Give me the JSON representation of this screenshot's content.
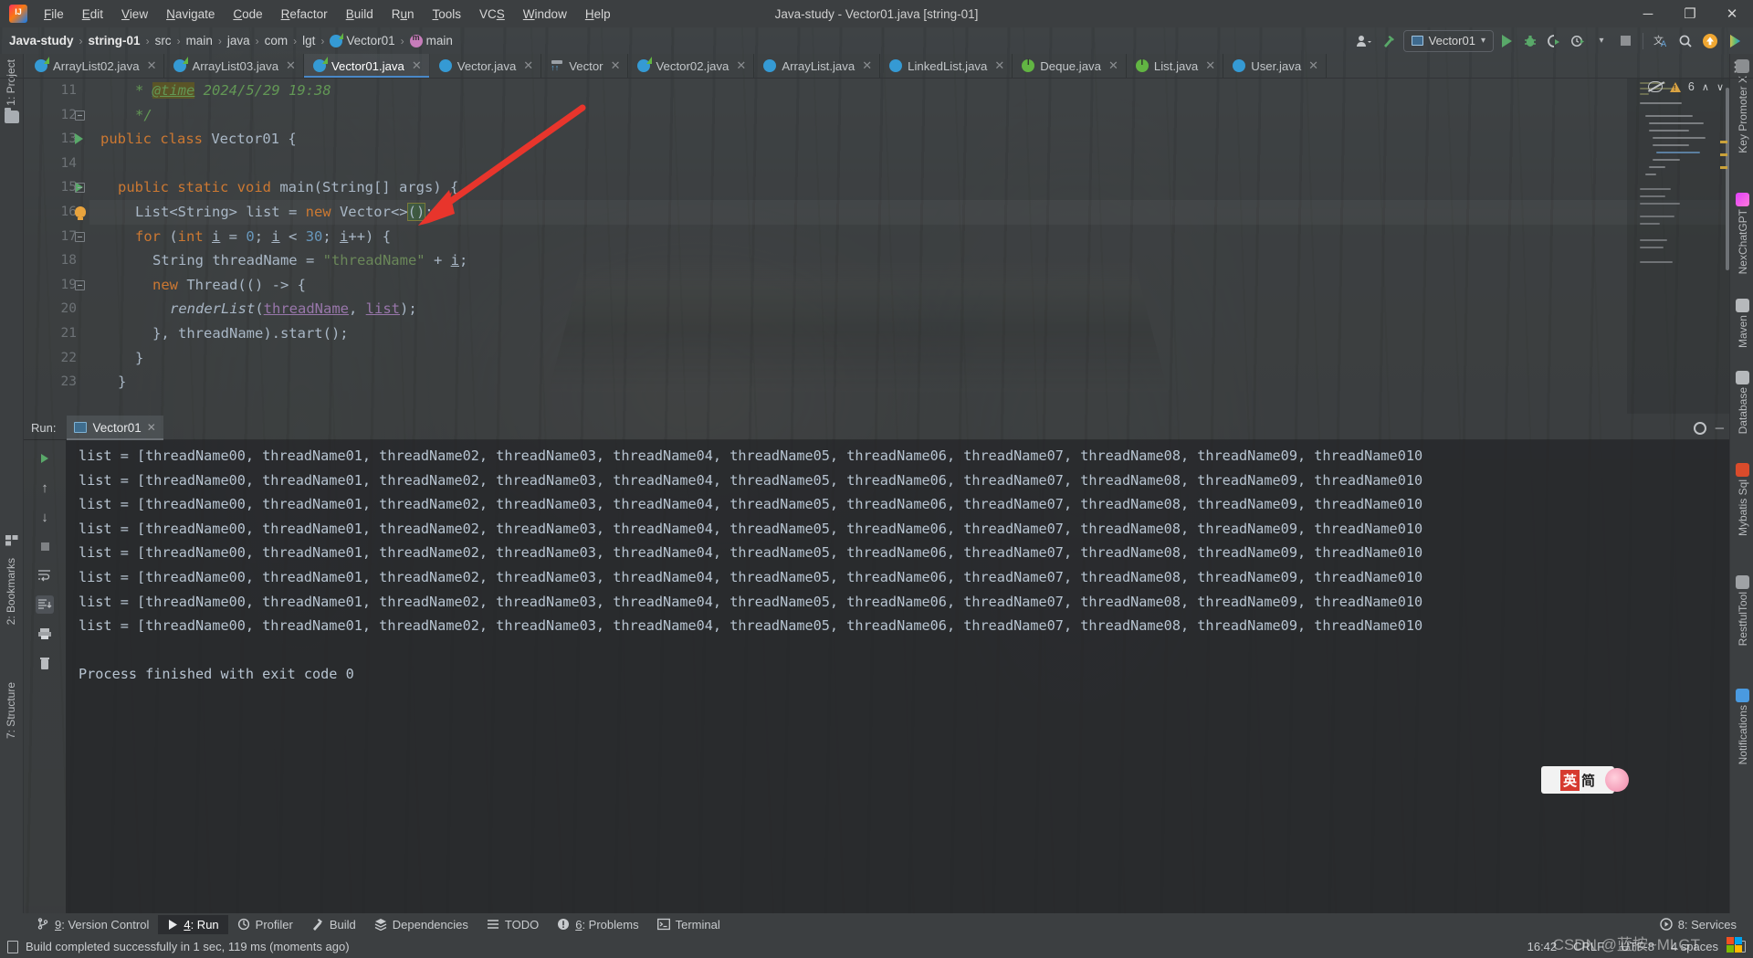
{
  "window": {
    "title": "Java-study - Vector01.java [string-01]",
    "logo_icon": "intellij-idea-logo",
    "minimize_label": "─",
    "maximize_label": "❐",
    "close_label": "✕"
  },
  "menubar": {
    "items": [
      {
        "label": "File",
        "mnemonic": "F"
      },
      {
        "label": "Edit",
        "mnemonic": "E"
      },
      {
        "label": "View",
        "mnemonic": "V"
      },
      {
        "label": "Navigate",
        "mnemonic": "N"
      },
      {
        "label": "Code",
        "mnemonic": "C"
      },
      {
        "label": "Refactor",
        "mnemonic": "R"
      },
      {
        "label": "Build",
        "mnemonic": "B"
      },
      {
        "label": "Run",
        "mnemonic": "u"
      },
      {
        "label": "Tools",
        "mnemonic": "T"
      },
      {
        "label": "VCS",
        "mnemonic": "S"
      },
      {
        "label": "Window",
        "mnemonic": "W"
      },
      {
        "label": "Help",
        "mnemonic": "H"
      }
    ]
  },
  "breadcrumb": {
    "items": [
      {
        "label": "Java-study",
        "bold": true,
        "icon": null
      },
      {
        "label": "string-01",
        "bold": true,
        "icon": null
      },
      {
        "label": "src",
        "bold": false,
        "icon": null
      },
      {
        "label": "main",
        "bold": false,
        "icon": null
      },
      {
        "label": "java",
        "bold": false,
        "icon": null
      },
      {
        "label": "com",
        "bold": false,
        "icon": null
      },
      {
        "label": "lgt",
        "bold": false,
        "icon": null
      },
      {
        "label": "Vector01",
        "bold": false,
        "icon": "class-icon"
      },
      {
        "label": "main",
        "bold": false,
        "icon": "method-icon"
      }
    ],
    "separator": "›"
  },
  "toolbar_right": {
    "account_icon": "account-icon",
    "build_icon": "hammer-icon",
    "run_config": {
      "label": "Vector01",
      "icon": "run-config-icon",
      "dropdown": "▾"
    },
    "run_icon": "run-play-icon",
    "debug_icon": "debug-bug-icon",
    "run_coverage_icon": "run-with-coverage-icon",
    "profiler_icon": "profiler-icon",
    "stop_icon": "stop-icon",
    "translate_icon": "translate-icon",
    "search_icon": "search-icon",
    "update_icon": "update-available-icon",
    "plugin_icon": "plugin-icon"
  },
  "tabs": {
    "more_icon": "more-tabs-icon",
    "close_glyph": "✕",
    "items": [
      {
        "label": "ArrayList02.java",
        "icon": "java-class-runnable-icon",
        "active": false
      },
      {
        "label": "ArrayList03.java",
        "icon": "java-class-runnable-icon",
        "active": false
      },
      {
        "label": "Vector01.java",
        "icon": "java-class-runnable-icon",
        "active": true
      },
      {
        "label": "Vector.java",
        "icon": "java-class-icon",
        "active": false
      },
      {
        "label": "Vector",
        "icon": "library-class-icon",
        "active": false
      },
      {
        "label": "Vector02.java",
        "icon": "java-class-runnable-icon",
        "active": false
      },
      {
        "label": "ArrayList.java",
        "icon": "java-class-icon",
        "active": false
      },
      {
        "label": "LinkedList.java",
        "icon": "java-class-icon",
        "active": false
      },
      {
        "label": "Deque.java",
        "icon": "java-interface-icon",
        "active": false
      },
      {
        "label": "List.java",
        "icon": "java-interface-icon",
        "active": false
      },
      {
        "label": "User.java",
        "icon": "java-class-icon",
        "active": false
      }
    ]
  },
  "left_strip": {
    "project_label": "1: Project",
    "project_icon": "folder-icon",
    "bookmarks_label": "2: Bookmarks",
    "structure_label": "7: Structure"
  },
  "right_strip": {
    "items": [
      {
        "label": "Key Promoter X",
        "icon": "key-promoter-icon"
      },
      {
        "label": "NexChatGPT",
        "icon": "nexchatgpt-icon"
      },
      {
        "label": "Maven",
        "icon": "maven-icon"
      },
      {
        "label": "Database",
        "icon": "database-icon"
      },
      {
        "label": "Mybatis Sql",
        "icon": "mybatis-icon"
      },
      {
        "label": "RestfulTool",
        "icon": "restful-tool-icon"
      },
      {
        "label": "Notifications",
        "icon": "notifications-bell-icon"
      }
    ]
  },
  "editor": {
    "inspection": {
      "eye_icon": "inspection-eye-off-icon",
      "warning_icon": "warning-triangle-icon",
      "warning_count": "6",
      "up_icon": "∧",
      "down_icon": "∨"
    },
    "lines": [
      {
        "no": "11",
        "indent": 2,
        "segments": [
          {
            "t": "* ",
            "c": "cmt"
          },
          {
            "t": "@time",
            "c": "tag"
          },
          {
            "t": " 2024/5/29 19:38",
            "c": "cmt"
          }
        ]
      },
      {
        "no": "12",
        "indent": 2,
        "fold": true,
        "segments": [
          {
            "t": "*/",
            "c": "cmt"
          }
        ]
      },
      {
        "no": "13",
        "indent": 0,
        "run": true,
        "segments": [
          {
            "t": "public class ",
            "c": "k"
          },
          {
            "t": "Vector01 ",
            "c": "typ"
          },
          {
            "t": "{",
            "c": "typ"
          }
        ]
      },
      {
        "no": "14",
        "indent": 0,
        "segments": []
      },
      {
        "no": "15",
        "indent": 1,
        "run": true,
        "fold": true,
        "segments": [
          {
            "t": "public static ",
            "c": "k"
          },
          {
            "t": "void ",
            "c": "k"
          },
          {
            "t": "main",
            "c": "typ"
          },
          {
            "t": "(String[] args) {",
            "c": "typ"
          }
        ]
      },
      {
        "no": "16",
        "indent": 2,
        "bulb": true,
        "highlight": true,
        "segments": [
          {
            "t": "List<String> list = ",
            "c": "typ"
          },
          {
            "t": "new ",
            "c": "k"
          },
          {
            "t": "Vector<>",
            "c": "typ"
          },
          {
            "t": "()",
            "c": "brace"
          },
          {
            "t": ";",
            "c": "typ"
          }
        ]
      },
      {
        "no": "17",
        "indent": 2,
        "fold": true,
        "segments": [
          {
            "t": "for ",
            "c": "k"
          },
          {
            "t": "(",
            "c": "typ"
          },
          {
            "t": "int ",
            "c": "k"
          },
          {
            "t": "i",
            "c": "var-u"
          },
          {
            "t": " = ",
            "c": "typ"
          },
          {
            "t": "0",
            "c": "num"
          },
          {
            "t": "; ",
            "c": "typ"
          },
          {
            "t": "i",
            "c": "var-u"
          },
          {
            "t": " < ",
            "c": "typ"
          },
          {
            "t": "30",
            "c": "num"
          },
          {
            "t": "; ",
            "c": "typ"
          },
          {
            "t": "i",
            "c": "var-u"
          },
          {
            "t": "++) {",
            "c": "typ"
          }
        ]
      },
      {
        "no": "18",
        "indent": 3,
        "segments": [
          {
            "t": "String threadName = ",
            "c": "typ"
          },
          {
            "t": "\"threadName\"",
            "c": "str"
          },
          {
            "t": " + ",
            "c": "typ"
          },
          {
            "t": "i",
            "c": "var-u"
          },
          {
            "t": ";",
            "c": "typ"
          }
        ]
      },
      {
        "no": "19",
        "indent": 3,
        "fold": true,
        "segments": [
          {
            "t": "new ",
            "c": "k"
          },
          {
            "t": "Thread(() -> {",
            "c": "typ"
          }
        ]
      },
      {
        "no": "20",
        "indent": 4,
        "segments": [
          {
            "t": "renderList",
            "c": "mth"
          },
          {
            "t": "(",
            "c": "typ"
          },
          {
            "t": "threadName",
            "c": "par"
          },
          {
            "t": ", ",
            "c": "typ"
          },
          {
            "t": "list",
            "c": "par"
          },
          {
            "t": ");",
            "c": "typ"
          }
        ]
      },
      {
        "no": "21",
        "indent": 3,
        "segments": [
          {
            "t": "}, threadName).start();",
            "c": "typ"
          }
        ]
      },
      {
        "no": "22",
        "indent": 2,
        "segments": [
          {
            "t": "}",
            "c": "typ"
          }
        ]
      },
      {
        "no": "23",
        "indent": 1,
        "segments": [
          {
            "t": "}",
            "c": "typ"
          }
        ]
      }
    ]
  },
  "run_window": {
    "label": "Run:",
    "tab": {
      "label": "Vector01",
      "icon": "run-tab-icon",
      "close": "✕"
    },
    "settings_icon": "gear-icon",
    "minimize_icon": "─",
    "side_buttons": [
      {
        "icon": "rerun-icon",
        "name": "rerun-button"
      },
      {
        "icon": "scroll-up-icon",
        "name": "up-button"
      },
      {
        "icon": "scroll-down-icon",
        "name": "down-button"
      },
      {
        "icon": "stop-icon",
        "name": "stop-button"
      },
      {
        "icon": "soft-wrap-icon",
        "name": "soft-wrap-button"
      },
      {
        "icon": "scroll-to-end-icon",
        "name": "scroll-to-end-button"
      },
      {
        "icon": "print-icon",
        "name": "print-button"
      },
      {
        "icon": "clear-all-icon",
        "name": "clear-all-button"
      }
    ],
    "console_line": "list = [threadName00, threadName01, threadName02, threadName03, threadName04, threadName05, threadName06, threadName07, threadName08, threadName09, threadName010",
    "console_lines": [
      "list = [threadName00, threadName01, threadName02, threadName03, threadName04, threadName05, threadName06, threadName07, threadName08, threadName09, threadName010",
      "list = [threadName00, threadName01, threadName02, threadName03, threadName04, threadName05, threadName06, threadName07, threadName08, threadName09, threadName010",
      "list = [threadName00, threadName01, threadName02, threadName03, threadName04, threadName05, threadName06, threadName07, threadName08, threadName09, threadName010",
      "list = [threadName00, threadName01, threadName02, threadName03, threadName04, threadName05, threadName06, threadName07, threadName08, threadName09, threadName010",
      "list = [threadName00, threadName01, threadName02, threadName03, threadName04, threadName05, threadName06, threadName07, threadName08, threadName09, threadName010",
      "list = [threadName00, threadName01, threadName02, threadName03, threadName04, threadName05, threadName06, threadName07, threadName08, threadName09, threadName010",
      "list = [threadName00, threadName01, threadName02, threadName03, threadName04, threadName05, threadName06, threadName07, threadName08, threadName09, threadName010",
      "list = [threadName00, threadName01, threadName02, threadName03, threadName04, threadName05, threadName06, threadName07, threadName08, threadName09, threadName010"
    ],
    "finish_line": "Process finished with exit code 0"
  },
  "bottom_bar": {
    "items": [
      {
        "label": "9: Version Control",
        "mnemonic": "9",
        "icon": "version-control-icon",
        "active": false
      },
      {
        "label": "4: Run",
        "mnemonic": "4",
        "icon": "run-play-icon",
        "active": true
      },
      {
        "label": "Profiler",
        "mnemonic": "",
        "icon": "profiler-icon",
        "active": false
      },
      {
        "label": "Build",
        "mnemonic": "",
        "icon": "hammer-icon",
        "active": false
      },
      {
        "label": "Dependencies",
        "mnemonic": "",
        "icon": "dependencies-icon",
        "active": false
      },
      {
        "label": "TODO",
        "mnemonic": "",
        "icon": "todo-list-icon",
        "active": false
      },
      {
        "label": "6: Problems",
        "mnemonic": "6",
        "icon": "problems-icon",
        "active": false
      },
      {
        "label": "Terminal",
        "mnemonic": "",
        "icon": "terminal-icon",
        "active": false
      }
    ],
    "services": {
      "label": "8: Services",
      "mnemonic": "8",
      "icon": "services-icon"
    }
  },
  "status_bar": {
    "message": "Build completed successfully in 1 sec, 119 ms (moments ago)",
    "message_icon": "build-status-icon",
    "time": "16:42",
    "line_separator": "CRLF",
    "encoding": "UTF-8",
    "indent": "4 spaces",
    "lock_icon": "lock-icon"
  },
  "overlay": {
    "ime_badge": {
      "cn": "英",
      "mode": "简"
    },
    "watermark": "CSDN @蓝按~MLGT",
    "arrow_color": "#e8352c"
  },
  "colors": {
    "accent": "#4a88c7",
    "green": "#59a869",
    "warning": "#d9a343",
    "background": "#3c3f41",
    "editor_bg": "#2b2b2b",
    "keyword": "#cc7832",
    "string": "#6a8759",
    "number": "#6897bb",
    "comment": "#629755"
  }
}
